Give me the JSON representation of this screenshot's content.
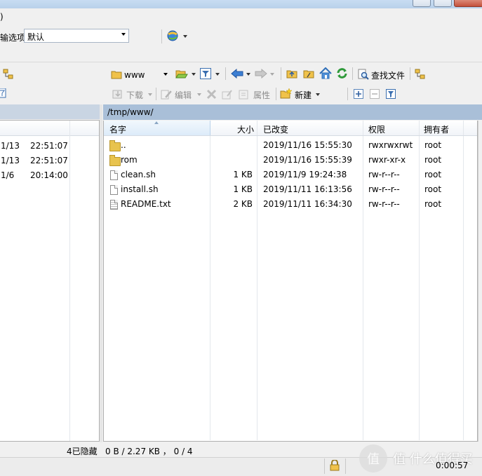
{
  "titlebar": {},
  "menubar": {
    "partial_item": ")"
  },
  "transfer_options": {
    "label": "输选项",
    "value": "默认"
  },
  "left_panel": {
    "rows": [
      {
        "date": "1/13",
        "time": "22:51:07"
      },
      {
        "date": "1/13",
        "time": "22:51:07"
      },
      {
        "date": "1/6",
        "time": "20:14:00"
      }
    ],
    "status": "4已隐藏"
  },
  "toolbar": {
    "path_combo_value": "www",
    "find_files_label": "查找文件",
    "download_label": "下载",
    "edit_label": "编辑",
    "properties_label": "属性",
    "new_label": "新建"
  },
  "right_panel": {
    "path": "/tmp/www/",
    "columns": {
      "name": "名字",
      "size": "大小",
      "modified": "已改变",
      "permissions": "权限",
      "owner": "拥有者"
    },
    "files": [
      {
        "name": "..",
        "size": "",
        "modified": "2019/11/16 15:55:30",
        "permissions": "rwxrwxrwt",
        "owner": "root",
        "icon": "parent-folder-icon"
      },
      {
        "name": "rom",
        "size": "",
        "modified": "2019/11/16 15:55:39",
        "permissions": "rwxr-xr-x",
        "owner": "root",
        "icon": "folder-icon"
      },
      {
        "name": "clean.sh",
        "size": "1 KB",
        "modified": "2019/11/9 19:24:38",
        "permissions": "rw-r--r--",
        "owner": "root",
        "icon": "file-icon"
      },
      {
        "name": "install.sh",
        "size": "1 KB",
        "modified": "2019/11/11 16:13:56",
        "permissions": "rw-r--r--",
        "owner": "root",
        "icon": "file-icon"
      },
      {
        "name": "README.txt",
        "size": "2 KB",
        "modified": "2019/11/11 16:34:30",
        "permissions": "rw-r--r--",
        "owner": "root",
        "icon": "text-file-icon"
      }
    ],
    "status": "0 B / 2.27 KB ， 0 / 4"
  },
  "statusbar": {
    "elapsed": "0:00:57",
    "watermark": "值 什么值得买"
  }
}
